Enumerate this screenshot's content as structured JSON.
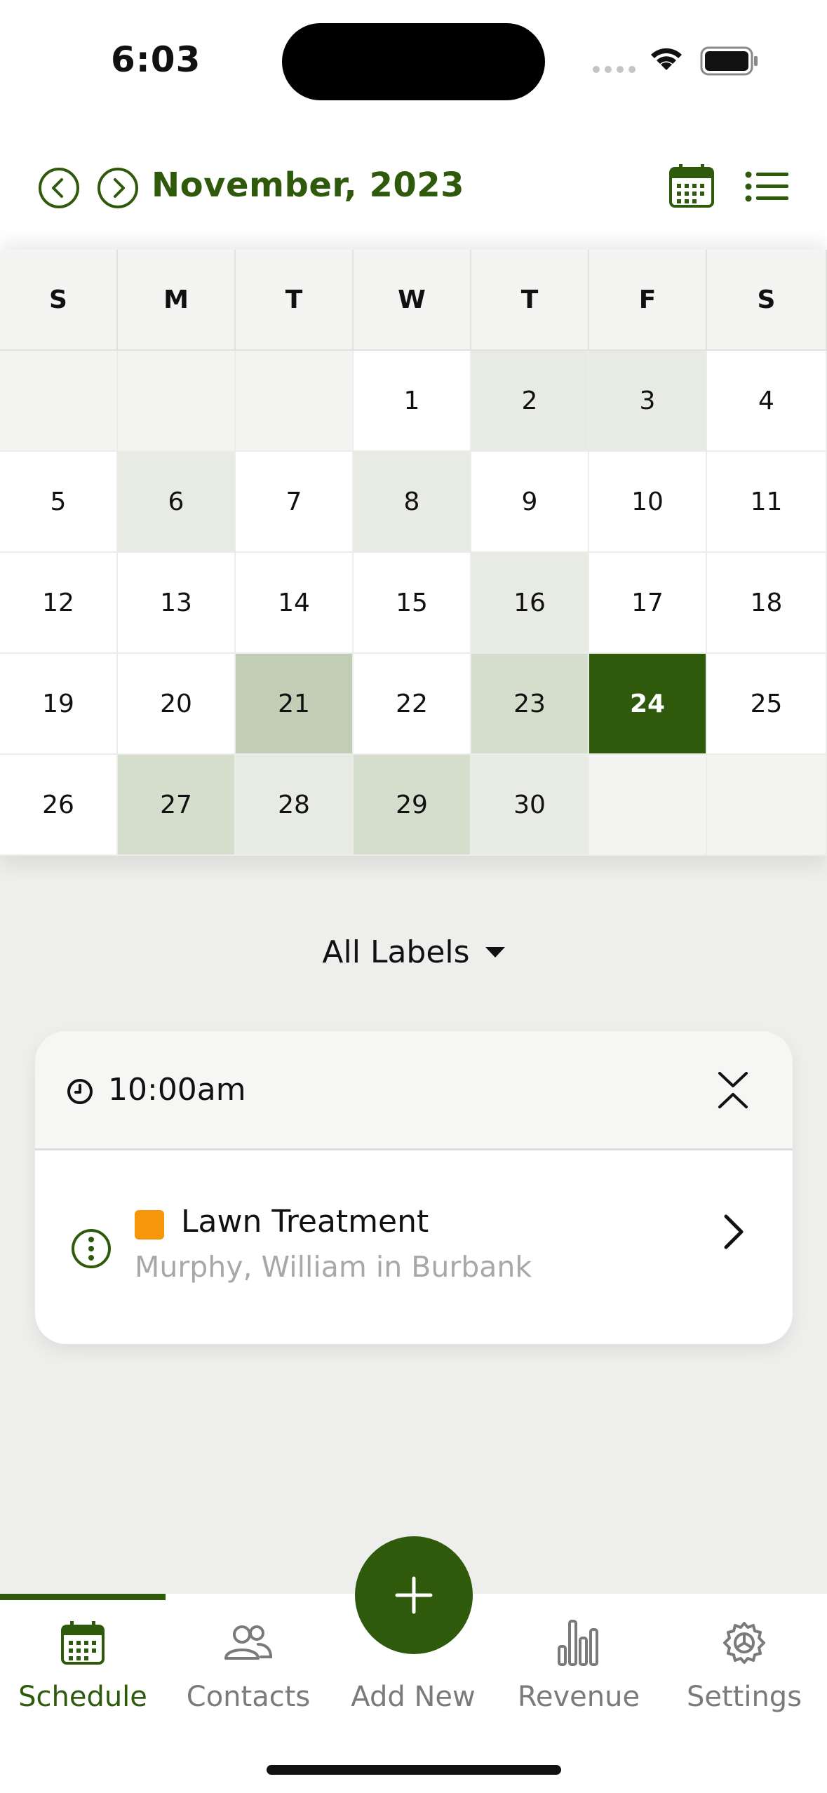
{
  "status_bar": {
    "time": "6:03"
  },
  "header": {
    "month_title": "November, 2023",
    "prev_icon": "chevron-left-circle-icon",
    "next_icon": "chevron-right-circle-icon",
    "calendar_view_icon": "calendar-icon",
    "list_view_icon": "list-icon",
    "accent_color": "#2f5a0c"
  },
  "calendar": {
    "weekdays": [
      "S",
      "M",
      "T",
      "W",
      "T",
      "F",
      "S"
    ],
    "weeks": [
      [
        {
          "d": ""
        },
        {
          "d": ""
        },
        {
          "d": ""
        },
        {
          "d": "1",
          "level": 0
        },
        {
          "d": "2",
          "level": 1
        },
        {
          "d": "3",
          "level": 1
        },
        {
          "d": "4",
          "level": 0
        }
      ],
      [
        {
          "d": "5",
          "level": 0
        },
        {
          "d": "6",
          "level": 1
        },
        {
          "d": "7",
          "level": 0
        },
        {
          "d": "8",
          "level": 1
        },
        {
          "d": "9",
          "level": 0
        },
        {
          "d": "10",
          "level": 0
        },
        {
          "d": "11",
          "level": 0
        }
      ],
      [
        {
          "d": "12",
          "level": 0
        },
        {
          "d": "13",
          "level": 0
        },
        {
          "d": "14",
          "level": 0
        },
        {
          "d": "15",
          "level": 0
        },
        {
          "d": "16",
          "level": 1
        },
        {
          "d": "17",
          "level": 0
        },
        {
          "d": "18",
          "level": 0
        }
      ],
      [
        {
          "d": "19",
          "level": 0
        },
        {
          "d": "20",
          "level": 0
        },
        {
          "d": "21",
          "level": 3
        },
        {
          "d": "22",
          "level": 0
        },
        {
          "d": "23",
          "level": 2
        },
        {
          "d": "24",
          "level": 0,
          "selected": true
        },
        {
          "d": "25",
          "level": 0
        }
      ],
      [
        {
          "d": "26",
          "level": 0
        },
        {
          "d": "27",
          "level": 2
        },
        {
          "d": "28",
          "level": 1
        },
        {
          "d": "29",
          "level": 2
        },
        {
          "d": "30",
          "level": 1
        },
        {
          "d": ""
        },
        {
          "d": ""
        }
      ]
    ],
    "selected_day": "24"
  },
  "labels_filter": {
    "label": "All Labels"
  },
  "event_group": {
    "time": "10:00am",
    "events": [
      {
        "title": "Lawn Treatment",
        "subtitle": "Murphy, William in Burbank",
        "label_color": "#f5960b"
      }
    ]
  },
  "tabbar": {
    "tabs": [
      {
        "label": "Schedule",
        "icon": "calendar-icon",
        "active": true
      },
      {
        "label": "Contacts",
        "icon": "people-icon",
        "active": false
      },
      {
        "label": "Add New",
        "icon": "plus-icon",
        "active": false
      },
      {
        "label": "Revenue",
        "icon": "bar-chart-icon",
        "active": false
      },
      {
        "label": "Settings",
        "icon": "gear-icon",
        "active": false
      }
    ]
  }
}
